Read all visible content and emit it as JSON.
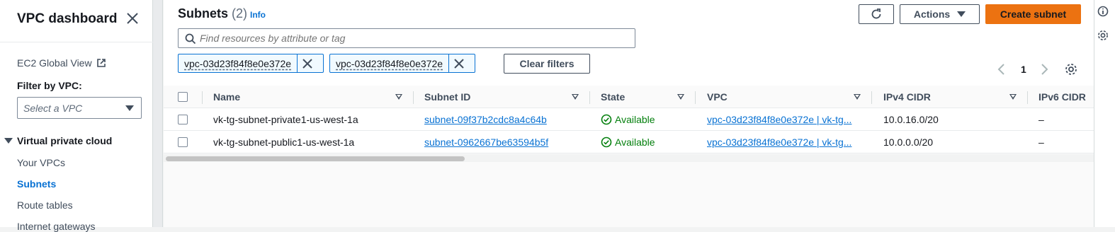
{
  "sidebar": {
    "title": "VPC dashboard",
    "ec2_global_view": "EC2 Global View",
    "filter_label": "Filter by VPC:",
    "filter_placeholder": "Select a VPC",
    "section_title": "Virtual private cloud",
    "items": [
      {
        "label": "Your VPCs",
        "active": false
      },
      {
        "label": "Subnets",
        "active": true
      },
      {
        "label": "Route tables",
        "active": false
      },
      {
        "label": "Internet gateways",
        "active": false
      }
    ]
  },
  "header": {
    "title": "Subnets",
    "count": "(2)",
    "info": "Info",
    "actions_label": "Actions",
    "create_label": "Create subnet",
    "search_placeholder": "Find resources by attribute or tag",
    "filter_tokens": [
      "vpc-03d23f84f8e0e372e",
      "vpc-03d23f84f8e0e372e"
    ],
    "clear_filters": "Clear filters",
    "page": "1"
  },
  "table": {
    "columns": [
      "Name",
      "Subnet ID",
      "State",
      "VPC",
      "IPv4 CIDR",
      "IPv6 CIDR"
    ],
    "rows": [
      {
        "name": "vk-tg-subnet-private1-us-west-1a",
        "subnet_id": "subnet-09f37b2cdc8a4c64b",
        "state": "Available",
        "vpc": "vpc-03d23f84f8e0e372e | vk-tg...",
        "ipv4": "10.0.16.0/20",
        "ipv6": "–"
      },
      {
        "name": "vk-tg-subnet-public1-us-west-1a",
        "subnet_id": "subnet-0962667be63594b5f",
        "state": "Available",
        "vpc": "vpc-03d23f84f8e0e372e | vk-tg...",
        "ipv4": "10.0.0.0/20",
        "ipv6": "–"
      }
    ]
  },
  "colors": {
    "accent": "#0972d3",
    "primary_button": "#ec7211",
    "status_ok": "#037f0c"
  }
}
